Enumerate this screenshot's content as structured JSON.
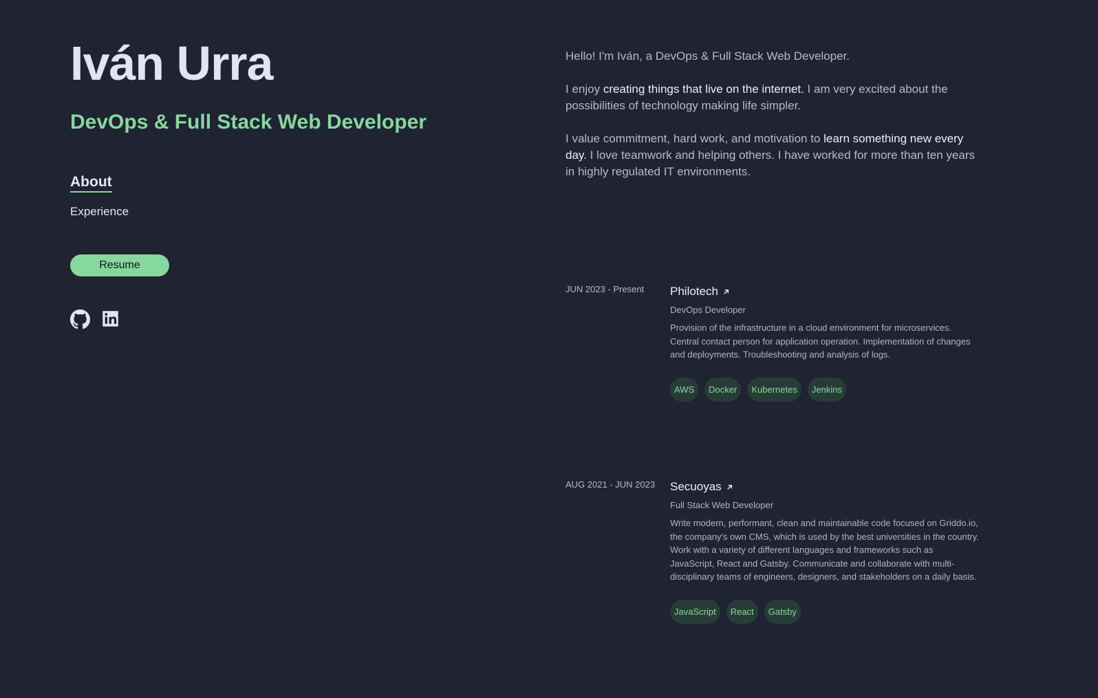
{
  "profile": {
    "name": "Iván Urra",
    "role": "DevOps & Full Stack Web Developer"
  },
  "nav": {
    "items": [
      {
        "label": "About",
        "active": true
      },
      {
        "label": "Experience",
        "active": false
      }
    ]
  },
  "resume": {
    "label": "Resume"
  },
  "socials": [
    {
      "icon": "github-icon"
    },
    {
      "icon": "linkedin-icon"
    }
  ],
  "about": {
    "p1": "Hello! I'm Iván, a DevOps & Full Stack Web Developer.",
    "p2_a": "I enjoy ",
    "p2_hl": "creating things that live on the internet.",
    "p2_b": " I am very excited about the possibilities of technology making life simpler.",
    "p3_a": "I value commitment, hard work, and motivation to ",
    "p3_hl": "learn something new every day.",
    "p3_b": " I love teamwork and helping others. I have worked for more than ten years in highly regulated IT environments."
  },
  "experience": [
    {
      "date": "JUN 2023 - Present",
      "company": "Philotech",
      "role": "DevOps Developer",
      "description": "Provision of the infrastructure in a cloud environment for microservices. Central contact person for application operation. Implementation of changes and deployments. Troubleshooting and analysis of logs.",
      "tags": [
        "AWS",
        "Docker",
        "Kubernetes",
        "Jenkins"
      ]
    },
    {
      "date": "AUG 2021 - JUN 2023",
      "company": "Secuoyas",
      "role": "Full Stack Web Developer",
      "description": "Write modern, performant, clean and maintainable code focused on Griddo.io, the company's own CMS, which is used by the best universities in the country. Work with a variety of different languages and frameworks such as JavaScript, React and Gatsby. Communicate and collaborate with multi-disciplinary teams of engineers, designers, and stakeholders on a daily basis.",
      "tags": [
        "JavaScript",
        "React",
        "Gatsby"
      ]
    }
  ],
  "colors": {
    "background": "#1f2332",
    "accent": "#86d89c",
    "tag_bg": "#283c37"
  }
}
